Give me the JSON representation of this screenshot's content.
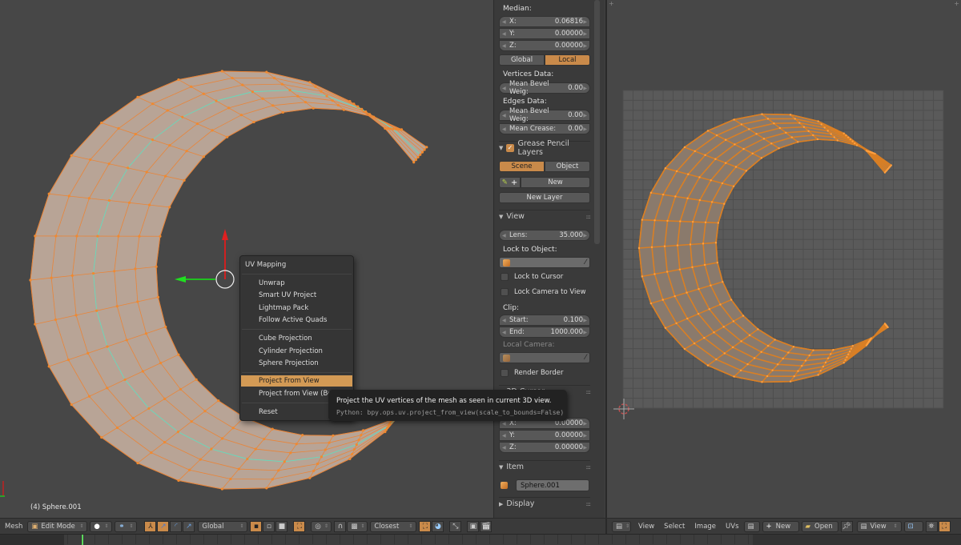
{
  "viewport3d": {
    "object_label": "(4) Sphere.001",
    "context_menu": {
      "title": "UV Mapping",
      "groups": [
        [
          "Unwrap",
          "Smart UV Project",
          "Lightmap Pack",
          "Follow Active Quads"
        ],
        [
          "Cube Projection",
          "Cylinder Projection",
          "Sphere Projection"
        ],
        [
          "Project From View",
          "Project from View (Bounds)"
        ],
        [
          "Reset"
        ]
      ],
      "items": [
        "Unwrap",
        "Smart UV Project",
        "Lightmap Pack",
        "Follow Active Quads",
        "Cube Projection",
        "Cylinder Projection",
        "Sphere Projection",
        "Project From View",
        "Project from View (Bo",
        "Reset"
      ],
      "highlighted": "Project From View"
    },
    "tooltip": {
      "description": "Project the UV vertices of the mesh as seen in current 3D view.",
      "python": "Python: bpy.ops.uv.project_from_view(scale_to_bounds=False)"
    }
  },
  "properties_panel": {
    "median_label": "Median:",
    "median": [
      {
        "label": "X:",
        "value": "0.06816"
      },
      {
        "label": "Y:",
        "value": "0.00000"
      },
      {
        "label": "Z:",
        "value": "0.00000"
      }
    ],
    "space_toggle": {
      "options": [
        "Global",
        "Local"
      ],
      "active": "Local"
    },
    "vertices_data_label": "Vertices Data:",
    "vertices_mean_bevel": {
      "label": "Mean Bevel Weig:",
      "value": "0.00"
    },
    "edges_data_label": "Edges Data:",
    "edges_mean_bevel": {
      "label": "Mean Bevel Weig:",
      "value": "0.00"
    },
    "edges_mean_crease": {
      "label": "Mean Crease:",
      "value": "0.00"
    },
    "grease_pencil": {
      "title": "Grease Pencil Layers",
      "enabled": true,
      "source": {
        "options": [
          "Scene",
          "Object"
        ],
        "active": "Scene"
      },
      "new_label": "New",
      "new_layer_label": "New Layer"
    },
    "view": {
      "title": "View",
      "lens": {
        "label": "Lens:",
        "value": "35.000"
      },
      "lock_to_object_label": "Lock to Object:",
      "lock_to_cursor": {
        "label": "Lock to Cursor",
        "checked": false
      },
      "lock_camera_to_view": {
        "label": "Lock Camera to View",
        "checked": false
      },
      "clip_label": "Clip:",
      "clip_start": {
        "label": "Start:",
        "value": "0.100"
      },
      "clip_end": {
        "label": "End:",
        "value": "1000.000"
      },
      "local_camera_label": "Local Camera:",
      "render_border": {
        "label": "Render Border",
        "checked": false
      }
    },
    "cursor3d": {
      "title": "3D Cursor",
      "location": [
        {
          "label": "X:",
          "value": "0.00000"
        },
        {
          "label": "Y:",
          "value": "0.00000"
        },
        {
          "label": "Z:",
          "value": "0.00000"
        }
      ]
    },
    "item": {
      "title": "Item",
      "name": "Sphere.001"
    },
    "display": {
      "title": "Display"
    }
  },
  "header3d": {
    "menu": "Mesh",
    "mode": "Edit Mode",
    "orientation": "Global",
    "snap_target": "Closest"
  },
  "header_uv": {
    "menus": [
      "View",
      "Select",
      "Image",
      "UVs"
    ],
    "new_label": "New",
    "open_label": "Open",
    "view_label": "View"
  }
}
